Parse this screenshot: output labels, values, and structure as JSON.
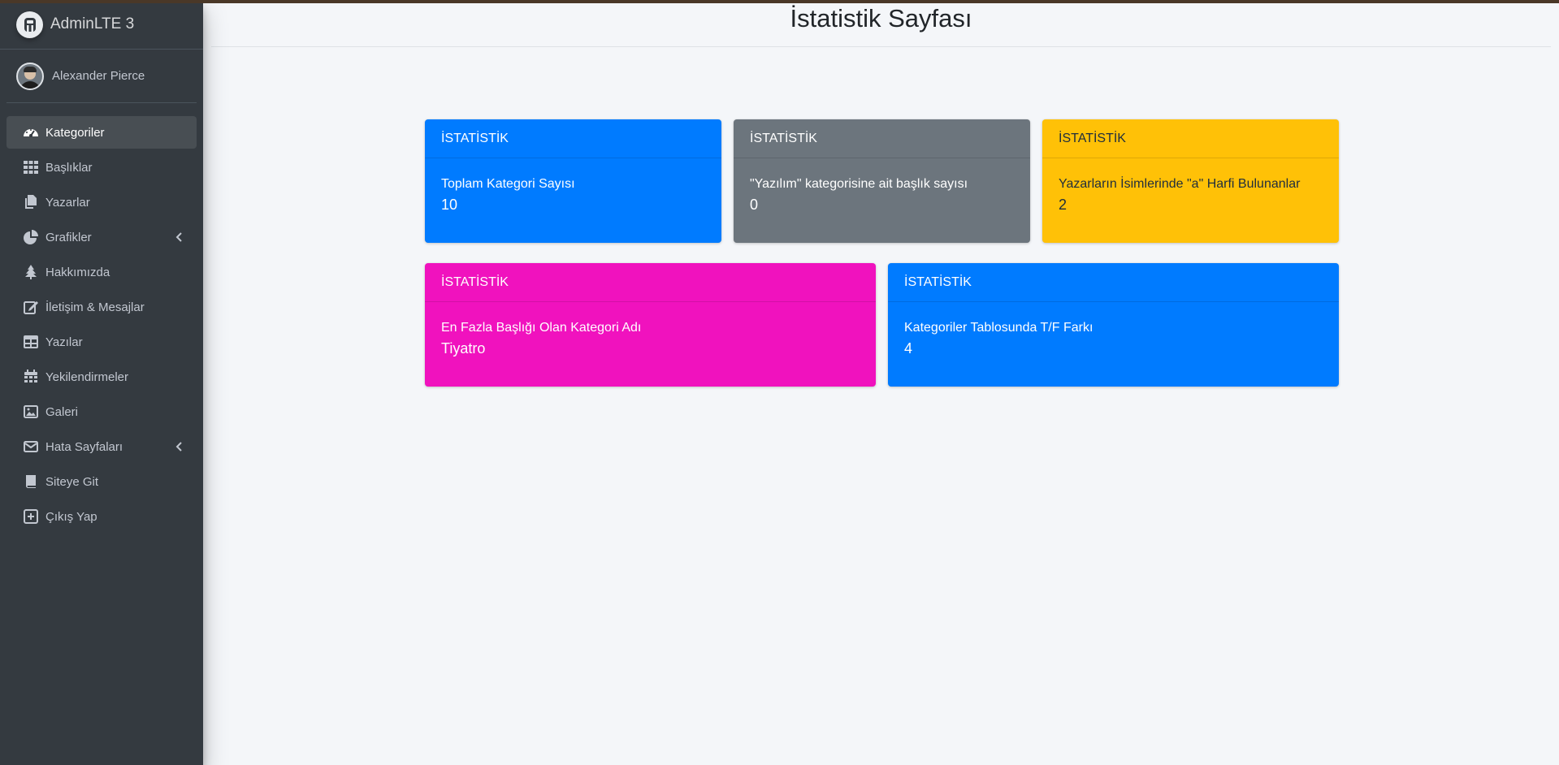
{
  "app": {
    "brand": "AdminLTE 3"
  },
  "user": {
    "name": "Alexander Pierce"
  },
  "sidebar": {
    "items": [
      {
        "label": "Kategoriler",
        "icon": "dashboard-icon"
      },
      {
        "label": "Başlıklar",
        "icon": "grid-icon"
      },
      {
        "label": "Yazarlar",
        "icon": "copy-icon"
      },
      {
        "label": "Grafikler",
        "icon": "chart-pie-icon"
      },
      {
        "label": "Hakkımızda",
        "icon": "tree-icon"
      },
      {
        "label": "İletişim & Mesajlar",
        "icon": "edit-icon"
      },
      {
        "label": "Yazılar",
        "icon": "table-icon"
      },
      {
        "label": "Yekilendirmeler",
        "icon": "calendar-icon"
      },
      {
        "label": "Galeri",
        "icon": "image-icon"
      },
      {
        "label": "Hata Sayfaları",
        "icon": "envelope-icon"
      },
      {
        "label": "Siteye Git",
        "icon": "book-icon"
      },
      {
        "label": "Çıkış Yap",
        "icon": "plus-square-icon"
      }
    ]
  },
  "page": {
    "title": "İstatistik Sayfası"
  },
  "cards": [
    {
      "header": "İSTATİSTİK",
      "label": "Toplam Kategori Sayısı",
      "value": "10",
      "color": "#007bff"
    },
    {
      "header": "İSTATİSTİK",
      "label": "\"Yazılım\" kategorisine ait başlık sayısı",
      "value": "0",
      "color": "#6c757d"
    },
    {
      "header": "İSTATİSTİK",
      "label": "Yazarların İsimlerinde \"a\" Harfi Bulunanlar",
      "value": "2",
      "color": "#ffc107"
    },
    {
      "header": "İSTATİSTİK",
      "label": "En Fazla Başlığı Olan Kategori Adı",
      "value": "Tiyatro",
      "color": "#f012be"
    },
    {
      "header": "İSTATİSTİK",
      "label": "Kategoriler Tablosunda T/F Farkı",
      "value": "4",
      "color": "#007bff"
    }
  ]
}
